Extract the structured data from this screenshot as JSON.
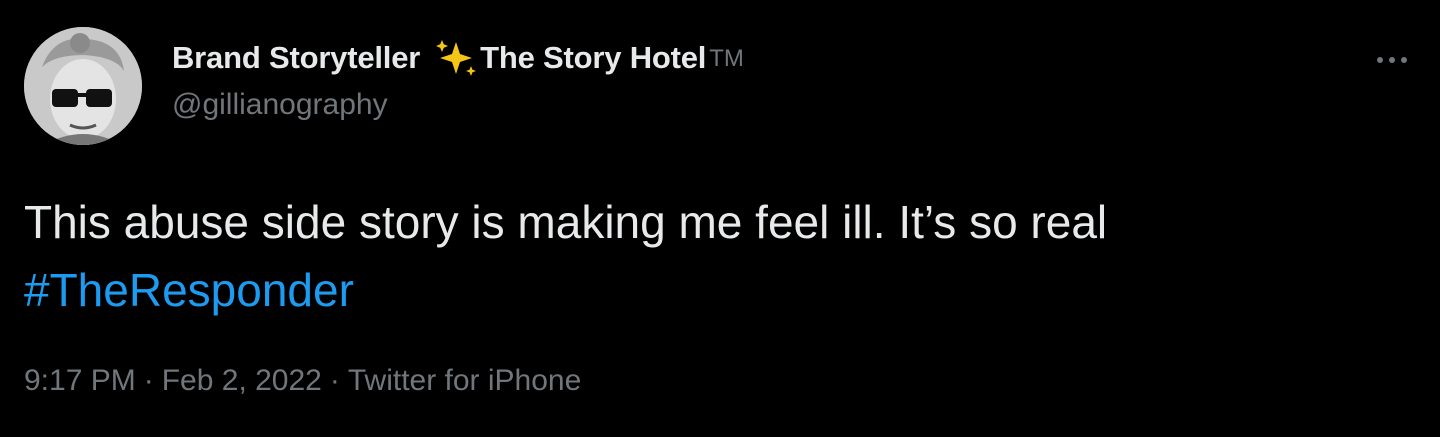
{
  "author": {
    "display_name": "Brand Storyteller",
    "display_name_suffix": "The Story Hotel",
    "trademark": "TM",
    "emoji_icon": "sparkles-icon",
    "handle": "@gillianography"
  },
  "tweet": {
    "text_line1": "This abuse side story is making me feel ill. It’s so real",
    "hashtag": "#TheResponder"
  },
  "meta": {
    "time": "9:17 PM",
    "date": "Feb 2, 2022",
    "source": "Twitter for iPhone",
    "separator": "·"
  },
  "colors": {
    "background": "#000000",
    "text": "#e7e9ea",
    "secondary": "#71767b",
    "link": "#1d9bf0",
    "sparkle": "#f5c518"
  }
}
